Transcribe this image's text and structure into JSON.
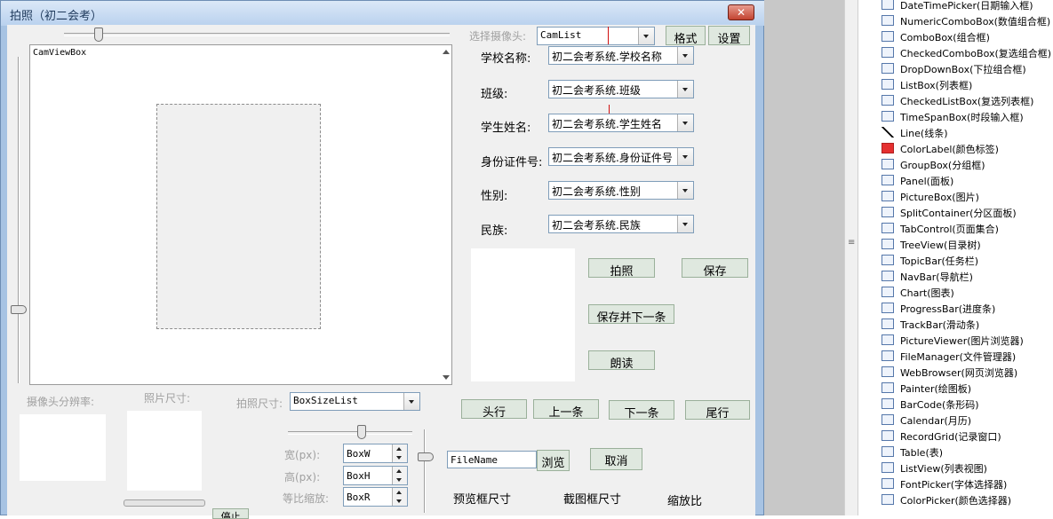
{
  "window": {
    "title": "拍照（初二会考）",
    "close": "✕"
  },
  "camview": {
    "label": "CamViewBox"
  },
  "camera": {
    "label": "选择摄像头:",
    "list": "CamList",
    "format_button": "格式",
    "settings_button": "设置"
  },
  "fields": [
    {
      "label": "学校名称:",
      "value": "初二会考系统.学校名称"
    },
    {
      "label": "班级:",
      "value": "初二会考系统.班级"
    },
    {
      "label": "学生姓名:",
      "value": "初二会考系统.学生姓名"
    },
    {
      "label": "身份证件号:",
      "value": "初二会考系统.身份证件号"
    },
    {
      "label": "性别:",
      "value": "初二会考系统.性别"
    },
    {
      "label": "民族:",
      "value": "初二会考系统.民族"
    }
  ],
  "buttons": {
    "capture": "拍照",
    "save": "保存",
    "save_next": "保存并下一条",
    "read": "朗读",
    "first": "头行",
    "prev": "上一条",
    "next": "下一条",
    "last": "尾行",
    "browse": "浏览",
    "cancel": "取消",
    "bottom_partial": "停止"
  },
  "lower": {
    "cam_resolution_label": "摄像头分辨率:",
    "photo_size_label": "照片尺寸:",
    "shot_size_label": "拍照尺寸:",
    "box_size_list": "BoxSizeList",
    "width_label": "宽(px):",
    "height_label": "高(px):",
    "ratio_label": "等比缩放:",
    "box_w": "BoxW",
    "box_h": "BoxH",
    "box_r": "BoxR",
    "filename": "FileName",
    "preview_size_label": "预览框尺寸",
    "crop_size_label": "截图框尺寸",
    "zoom_ratio_label": "缩放比"
  },
  "toolbox": [
    {
      "label": "DateTimePicker(日期输入框)",
      "icon": "calendar-icon"
    },
    {
      "label": "NumericComboBox(数值组合框)",
      "icon": "numeric-combo-icon"
    },
    {
      "label": "ComboBox(组合框)",
      "icon": "combo-icon"
    },
    {
      "label": "CheckedComboBox(复选组合框)",
      "icon": "checked-combo-icon"
    },
    {
      "label": "DropDownBox(下拉组合框)",
      "icon": "dropdown-icon"
    },
    {
      "label": "ListBox(列表框)",
      "icon": "listbox-icon"
    },
    {
      "label": "CheckedListBox(复选列表框)",
      "icon": "checked-list-icon"
    },
    {
      "label": "TimeSpanBox(时段输入框)",
      "icon": "clock-icon"
    },
    {
      "label": "Line(线条)",
      "icon": "line-icon"
    },
    {
      "label": "ColorLabel(颜色标签)",
      "icon": "color-label-icon"
    },
    {
      "label": "GroupBox(分组框)",
      "icon": "groupbox-icon"
    },
    {
      "label": "Panel(面板)",
      "icon": "panel-icon"
    },
    {
      "label": "PictureBox(图片)",
      "icon": "picture-icon"
    },
    {
      "label": "SplitContainer(分区面板)",
      "icon": "split-icon"
    },
    {
      "label": "TabControl(页面集合)",
      "icon": "tab-icon"
    },
    {
      "label": "TreeView(目录树)",
      "icon": "tree-icon"
    },
    {
      "label": "TopicBar(任务栏)",
      "icon": "topicbar-icon"
    },
    {
      "label": "NavBar(导航栏)",
      "icon": "navbar-icon"
    },
    {
      "label": "Chart(图表)",
      "icon": "chart-icon"
    },
    {
      "label": "ProgressBar(进度条)",
      "icon": "progress-icon"
    },
    {
      "label": "TrackBar(滑动条)",
      "icon": "trackbar-icon"
    },
    {
      "label": "PictureViewer(图片浏览器)",
      "icon": "picture-viewer-icon"
    },
    {
      "label": "FileManager(文件管理器)",
      "icon": "file-manager-icon"
    },
    {
      "label": "WebBrowser(网页浏览器)",
      "icon": "web-browser-icon"
    },
    {
      "label": "Painter(绘图板)",
      "icon": "painter-icon"
    },
    {
      "label": "BarCode(条形码)",
      "icon": "barcode-icon"
    },
    {
      "label": "Calendar(月历)",
      "icon": "month-calendar-icon"
    },
    {
      "label": "RecordGrid(记录窗口)",
      "icon": "grid-icon"
    },
    {
      "label": "Table(表)",
      "icon": "table-icon"
    },
    {
      "label": "ListView(列表视图)",
      "icon": "listview-icon"
    },
    {
      "label": "FontPicker(字体选择器)",
      "icon": "font-icon"
    },
    {
      "label": "ColorPicker(颜色选择器)",
      "icon": "color-picker-icon"
    }
  ]
}
